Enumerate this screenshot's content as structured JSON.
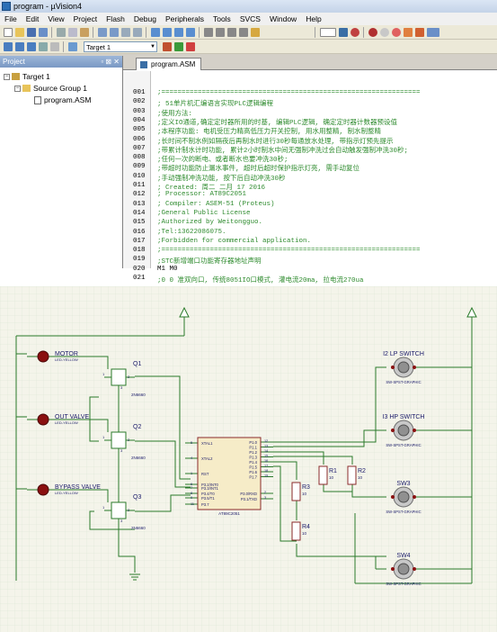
{
  "window": {
    "title": "program - µVision4"
  },
  "menu": [
    "File",
    "Edit",
    "View",
    "Project",
    "Flash",
    "Debug",
    "Peripherals",
    "Tools",
    "SVCS",
    "Window",
    "Help"
  ],
  "toolbar": {
    "target": "Target 1"
  },
  "project_panel": {
    "title": "Project",
    "controls": "▫ ⊠ ✕",
    "target": "Target 1",
    "group": "Source Group 1",
    "file": "program.ASM"
  },
  "editor": {
    "tab": "program.ASM",
    "lines": [
      {
        "n": "001",
        "t": ";================================================================"
      },
      {
        "n": "002",
        "t": "; 51单片机汇编语言实现PLC逻辑编程"
      },
      {
        "n": "003",
        "t": ";使用方法:"
      },
      {
        "n": "004",
        "t": ";定义IO通道,确定定时器所用的时基, 编辑PLC逻辑, 确定定时器计数器预设值"
      },
      {
        "n": "005",
        "t": ";本程序功能: 电机受压力精高低压力开关控制, 用水用整精, 制水制整精"
      },
      {
        "n": "006",
        "t": ";长时间不制水例如隔夜后再制水时进行30秒每通放水处理, 带指示灯预先提示"
      },
      {
        "n": "007",
        "t": ";带累计制水计时功能, 累计2小时制水中间无强制冲洗过会自动触发强制冲洗30秒;"
      },
      {
        "n": "008",
        "t": ";任何一次的断电、或者断水也要冲洗30秒;"
      },
      {
        "n": "009",
        "t": ";带超时功能防止漏水事件, 超时后超时保护指示灯亮, 需手动复位"
      },
      {
        "n": "010",
        "t": ";手动强制冲洗功能, 按下后自动冲洗30秒"
      },
      {
        "n": "011",
        "t": "; Created:   周二 二月 17 2016"
      },
      {
        "n": "012",
        "t": "; Processor: AT89C2051"
      },
      {
        "n": "013",
        "t": "; Compiler:  ASEM-51 (Proteus)"
      },
      {
        "n": "014",
        "t": ";General Public License"
      },
      {
        "n": "015",
        "t": ";Authorized by Weitongguo."
      },
      {
        "n": "016",
        "t": ";Tel:13622086075."
      },
      {
        "n": "017",
        "t": ";Forbidden for commercial application."
      },
      {
        "n": "018",
        "t": ";================================================================"
      },
      {
        "n": "019",
        "t": ";STC新增端口功能寄存器地址声明"
      },
      {
        "n": "020",
        "t": "M1     M0"
      },
      {
        "n": "021",
        "t": ";0     0    准双向口, 传统8051IO口模式, 灌电流20ma, 拉电流270ua"
      }
    ]
  },
  "schematic": {
    "leds": [
      {
        "name": "MOTOR",
        "type": "LED-YELLOW"
      },
      {
        "name": "OUT VALVE",
        "type": "LED-YELLOW"
      },
      {
        "name": "BYPASS VALVE",
        "type": "LED-YELLOW"
      }
    ],
    "transistors": [
      {
        "ref": "Q1",
        "part": "2N6660"
      },
      {
        "ref": "Q2",
        "part": "2N6660"
      },
      {
        "ref": "Q3",
        "part": "2N6660"
      }
    ],
    "mcu": {
      "ref": "U1",
      "part": "AT89C2051",
      "left_pins": [
        "XTAL1",
        "XTAL2",
        "RST",
        "P3.2/INT0",
        "P3.3/INT1",
        "P3.4/T0",
        "P3.5/T1",
        "P3.7"
      ],
      "right_pins": [
        "P1.0",
        "P1.1",
        "P1.2",
        "P1.3",
        "P1.4",
        "P1.5",
        "P1.6",
        "P1.7",
        "P3.0/RXD",
        "P3.1/TXD"
      ],
      "left_nums": [
        "5",
        "4",
        "1",
        "6",
        "7",
        "8",
        "9",
        "11"
      ],
      "right_nums": [
        "12",
        "13",
        "14",
        "15",
        "16",
        "17",
        "18",
        "19",
        "2",
        "3"
      ]
    },
    "resistors": [
      {
        "ref": "R1",
        "value": "10"
      },
      {
        "ref": "R2",
        "value": "10"
      },
      {
        "ref": "R3",
        "value": "10"
      },
      {
        "ref": "R4",
        "value": "10"
      }
    ],
    "switches": [
      {
        "ref": "I2 LP SWITCH",
        "part": "SW-SPST-GRAPHIC"
      },
      {
        "ref": "I3 HP SWITCH",
        "part": "SW-SPST-GRAPHIC"
      },
      {
        "ref": "SW3",
        "part": "SW-SPST-GRAPHIC"
      },
      {
        "ref": "SW4",
        "part": "SW-SPST-GRAPHIC"
      }
    ],
    "pin_labels": {
      "one": "1",
      "two": "2",
      "three": "3"
    }
  }
}
